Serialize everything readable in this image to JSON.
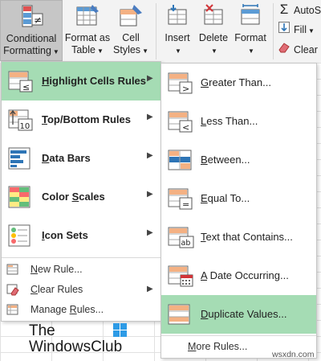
{
  "ribbon": {
    "conditional_formatting": {
      "line1": "Conditional",
      "line2": "Formatting"
    },
    "format_as_table": {
      "line1": "Format as",
      "line2": "Table"
    },
    "cell_styles": {
      "line1": "Cell",
      "line2": "Styles"
    },
    "insert": "Insert",
    "delete": "Delete",
    "format": "Format",
    "autosum": "AutoS",
    "fill": "Fill",
    "clear": "Clear"
  },
  "menu": {
    "items": [
      {
        "pre": "",
        "u": "H",
        "post": "ighlight Cells Rules"
      },
      {
        "pre": "",
        "u": "T",
        "post": "op/Bottom Rules"
      },
      {
        "pre": "",
        "u": "D",
        "post": "ata Bars"
      },
      {
        "pre": "Color ",
        "u": "S",
        "post": "cales"
      },
      {
        "pre": "",
        "u": "I",
        "post": "con Sets"
      }
    ],
    "small": [
      {
        "pre": "",
        "u": "N",
        "post": "ew Rule..."
      },
      {
        "pre": "",
        "u": "C",
        "post": "lear Rules"
      },
      {
        "pre": "Manage ",
        "u": "R",
        "post": "ules..."
      }
    ]
  },
  "submenu": {
    "items": [
      {
        "pre": "",
        "u": "G",
        "post": "reater Than..."
      },
      {
        "pre": "",
        "u": "L",
        "post": "ess Than..."
      },
      {
        "pre": "",
        "u": "B",
        "post": "etween..."
      },
      {
        "pre": "",
        "u": "E",
        "post": "qual To..."
      },
      {
        "pre": "",
        "u": "T",
        "post": "ext that Contains..."
      },
      {
        "pre": "",
        "u": "A",
        "post": " Date Occurring..."
      },
      {
        "pre": "",
        "u": "D",
        "post": "uplicate Values..."
      }
    ],
    "more": {
      "pre": "",
      "u": "M",
      "post": "ore Rules..."
    }
  },
  "watermark": {
    "line1": "The",
    "line2": "WindowsClub",
    "url": "wsxdn.com"
  },
  "colors": {
    "highlight": "#a5dcb4",
    "accent": "#217346",
    "icon_blue": "#2e75b6",
    "icon_orange": "#f4b183"
  }
}
